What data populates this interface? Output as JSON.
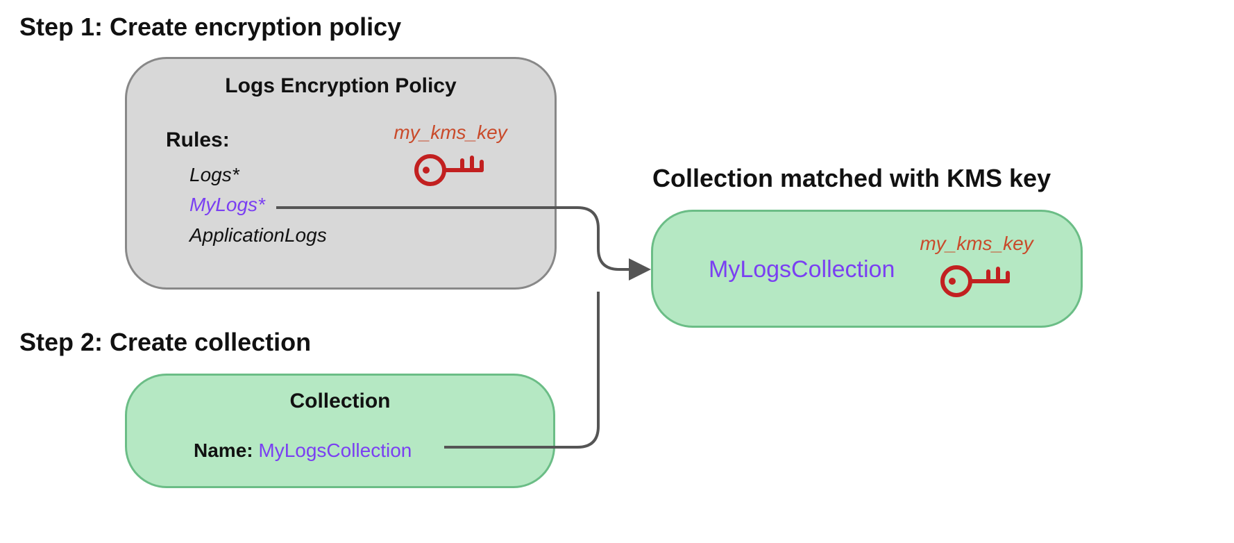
{
  "step1": {
    "heading": "Step 1: Create encryption policy",
    "panel_title": "Logs Encryption Policy",
    "rules_label": "Rules:",
    "rules": {
      "r0": "Logs*",
      "r1": "MyLogs*",
      "r2": "ApplicationLogs"
    },
    "key_label": "my_kms_key"
  },
  "step2": {
    "heading": "Step 2: Create collection",
    "panel_title": "Collection",
    "name_label": "Name: ",
    "name_value": "MyLogsCollection"
  },
  "result": {
    "heading": "Collection matched with KMS key",
    "collection_name": "MyLogsCollection",
    "key_label": "my_kms_key"
  },
  "colors": {
    "purple": "#7a3ff2",
    "keyred": "#c94a2a",
    "grey_bg": "#d8d8d8",
    "grey_border": "#888888",
    "green_bg": "#b5e8c3",
    "green_border": "#6bbd86"
  }
}
